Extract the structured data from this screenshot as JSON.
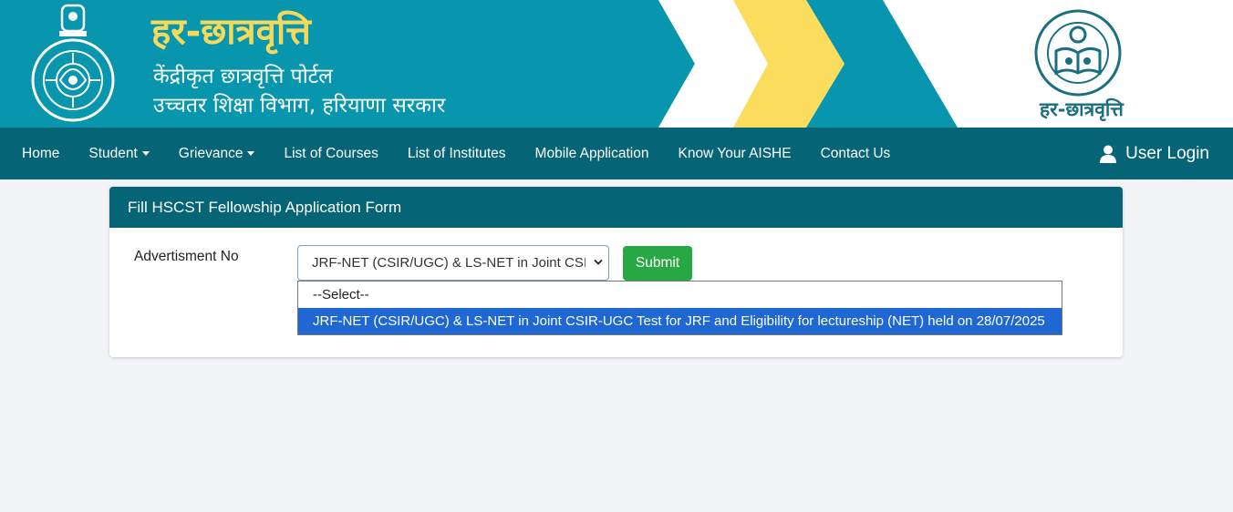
{
  "header": {
    "title": "हर-छात्रवृत्ति",
    "subtitle_line1": "केंद्रीकृत छात्रवृत्ति पोर्टल",
    "subtitle_line2": "उच्चतर शिक्षा विभाग, हरियाणा सरकार",
    "emblem_icon": "haryana-emblem-icon",
    "dhe_logo_icon": "department-of-higher-education-logo-icon",
    "dhe_logo_name": "हर-छात्रवृत्ति",
    "colors": {
      "teal": "#0796ae",
      "yellow": "#fbdc5c",
      "title_yellow": "#f6d95a"
    }
  },
  "navbar": {
    "items": [
      {
        "label": "Home",
        "dropdown": false
      },
      {
        "label": "Student",
        "dropdown": true
      },
      {
        "label": "Grievance",
        "dropdown": true
      },
      {
        "label": "List of Courses",
        "dropdown": false
      },
      {
        "label": "List of Institutes",
        "dropdown": false
      },
      {
        "label": "Mobile Application",
        "dropdown": false
      },
      {
        "label": "Know Your AISHE",
        "dropdown": false
      },
      {
        "label": "Contact Us",
        "dropdown": false
      }
    ],
    "user_login": "User Login",
    "user_icon": "user-icon",
    "color": "#056577"
  },
  "form": {
    "header": "Fill HSCST Fellowship Application Form",
    "field_label": "Advertisment No",
    "selected_value": "JRF-NET (CSIR/UGC) & LS-NET in Joint CSIR-UGC Test for JRF and Eligibility for lectureship (NET) held on 28/07/2025",
    "submit_label": "Submit",
    "options": [
      {
        "label": "--Select--",
        "selected": false
      },
      {
        "label": "JRF-NET (CSIR/UGC) & LS-NET in Joint CSIR-UGC Test for JRF and Eligibility for lectureship (NET) held on 28/07/2025",
        "selected": true
      }
    ],
    "submit_color": "#28a745",
    "highlight_color": "#1f67d2"
  }
}
